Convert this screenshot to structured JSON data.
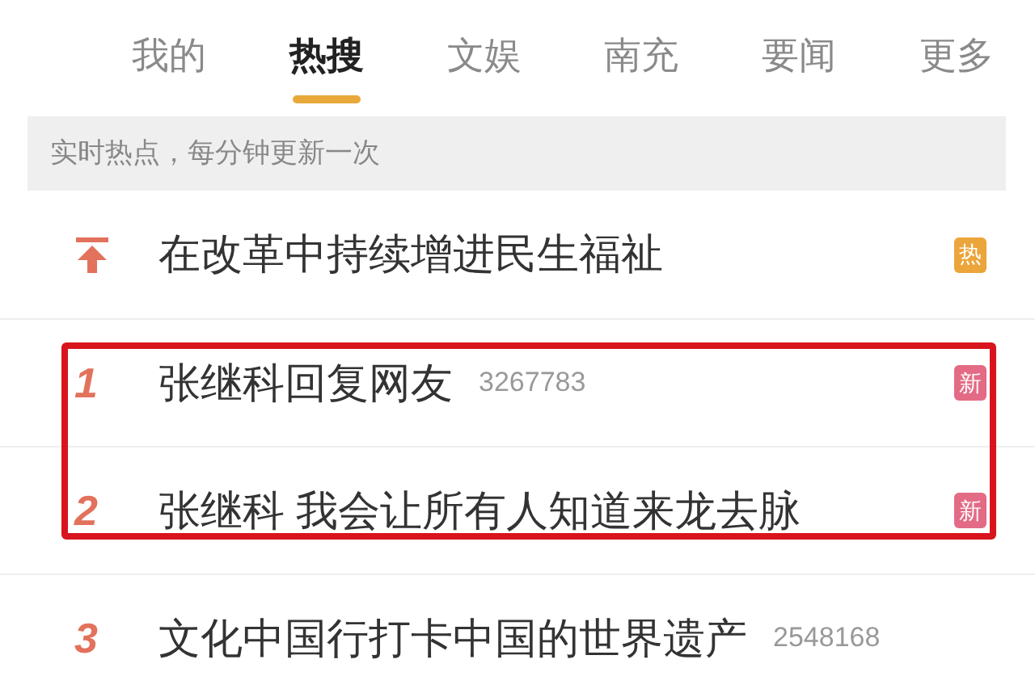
{
  "tabs": [
    {
      "label": "我的",
      "selected": false
    },
    {
      "label": "热搜",
      "selected": true
    },
    {
      "label": "文娱",
      "selected": false
    },
    {
      "label": "南充",
      "selected": false
    },
    {
      "label": "要闻",
      "selected": false
    },
    {
      "label": "更多",
      "selected": false
    }
  ],
  "notice": "实时热点，每分钟更新一次",
  "rows": [
    {
      "kind": "pinned",
      "title": "在改革中持续增进民生福祉",
      "badge": "热",
      "color": "#eba53a",
      "highlighted": false
    },
    {
      "kind": "ranked",
      "rank": "1",
      "title": "张继科回复网友",
      "count": "3267783",
      "badge": "新",
      "color": "#e36b85",
      "highlighted": true
    },
    {
      "kind": "ranked",
      "rank": "2",
      "title": "张继科 我会让所有人知道来龙去脉",
      "badge": "新",
      "color": "#e36b85",
      "highlighted": true
    },
    {
      "kind": "ranked",
      "rank": "3",
      "title": "文化中国行打卡中国的世界遗产",
      "count": "2548168",
      "highlighted": false
    }
  ]
}
